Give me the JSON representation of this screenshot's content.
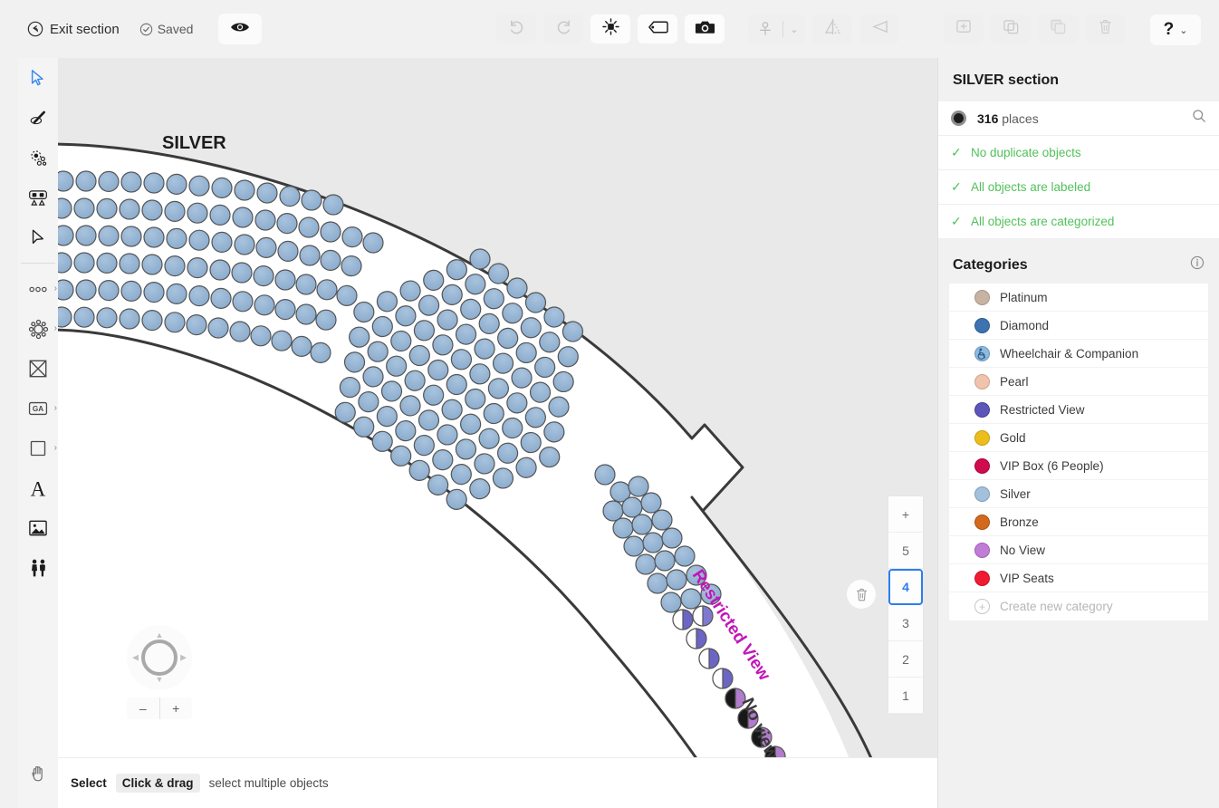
{
  "toolbar": {
    "exit_label": "Exit section",
    "saved_label": "Saved",
    "preview_icon": "eye-icon",
    "undo_icon": "undo-icon",
    "redo_icon": "redo-icon",
    "focal_icon": "focal-point-icon",
    "label_icon": "tag-icon",
    "camera_icon": "camera-icon",
    "align_icon": "align-icon",
    "align_chevron": "⌄",
    "flip_v_icon": "flip-vertical-icon",
    "flip_h_icon": "flip-horizontal-icon",
    "add_copy_icon": "add-duplicate-icon",
    "duplicate_icon": "duplicate-icon",
    "copy_icon": "copy-icon",
    "delete_icon": "trash-icon",
    "help_label": "?",
    "help_chevron": "⌄"
  },
  "tools": [
    {
      "name": "select-tool",
      "icon": "cursor-arrow-icon",
      "active": true,
      "chevron": ""
    },
    {
      "name": "magic-wand-tool",
      "icon": "magic-wand-icon",
      "active": false,
      "chevron": ""
    },
    {
      "name": "focal-point-tool",
      "icon": "focal-dots-icon",
      "active": false,
      "chevron": ""
    },
    {
      "name": "section-tool",
      "icon": "seating-section-icon",
      "active": false,
      "chevron": ""
    },
    {
      "name": "direct-select-tool",
      "icon": "solid-arrow-icon",
      "active": false,
      "chevron": ""
    },
    {
      "name": "row-tool",
      "icon": "row-of-seats-icon",
      "active": false,
      "chevron": "›"
    },
    {
      "name": "table-tool",
      "icon": "round-table-icon",
      "active": false,
      "chevron": "›"
    },
    {
      "name": "shape-tool",
      "icon": "crossed-box-icon",
      "active": false,
      "chevron": ""
    },
    {
      "name": "ga-tool",
      "icon": "general-admission-icon",
      "active": false,
      "chevron": "›"
    },
    {
      "name": "rectangle-tool",
      "icon": "square-icon",
      "active": false,
      "chevron": "›"
    },
    {
      "name": "text-tool",
      "icon": "letter-a-icon",
      "active": false,
      "chevron": ""
    },
    {
      "name": "image-tool",
      "icon": "picture-icon",
      "active": false,
      "chevron": ""
    },
    {
      "name": "people-tool",
      "icon": "two-people-icon",
      "active": false,
      "chevron": ""
    }
  ],
  "hand_tool": {
    "name": "pan-hand-tool",
    "icon": "hand-icon"
  },
  "canvas": {
    "section_label": "SILVER",
    "restricted_view_label": "Restricted View",
    "no_view_label": "No view",
    "seat_fill": "#8FAFD0",
    "seat_stroke": "#4a4a4a",
    "restricted_fill": "#5B56B8",
    "noview_fill": "#B27BCB",
    "bg": "#e9e9e9",
    "section_fill": "#ffffff",
    "restricted_label_color": "#C216B8",
    "noview_label_color": "#3a3a3a"
  },
  "navigation": {
    "pad_icon": "direction-pad",
    "up": "▲",
    "down": "▼",
    "left": "◀",
    "right": "▶",
    "zoom_out": "–",
    "zoom_in": "+"
  },
  "levels": {
    "add_label": "+",
    "items": [
      "5",
      "4",
      "3",
      "2",
      "1"
    ],
    "selected": "4",
    "delete_icon": "trash-icon"
  },
  "panel": {
    "title": "SILVER section",
    "places_count": "316",
    "places_word": "places",
    "search_icon": "search-icon",
    "checks": [
      "No duplicate objects",
      "All objects are labeled",
      "All objects are categorized"
    ],
    "check_mark": "✓",
    "categories_title": "Categories",
    "info_icon": "info-icon",
    "categories": [
      {
        "label": "Platinum",
        "color": "#C6B3A4"
      },
      {
        "label": "Diamond",
        "color": "#3E72B0"
      },
      {
        "label": "Wheelchair & Companion",
        "color": "#8FBADF",
        "icon": "wheelchair-icon"
      },
      {
        "label": "Pearl",
        "color": "#EFC3AC"
      },
      {
        "label": "Restricted View",
        "color": "#5B56B8"
      },
      {
        "label": "Gold",
        "color": "#EDBE1B"
      },
      {
        "label": "VIP Box (6 People)",
        "color": "#D00B4E"
      },
      {
        "label": "Silver",
        "color": "#A3C0DC"
      },
      {
        "label": "Bronze",
        "color": "#D2691C"
      },
      {
        "label": "No View",
        "color": "#C17DD6"
      },
      {
        "label": "VIP Seats",
        "color": "#F01B32"
      }
    ],
    "create_label": "Create new category",
    "create_icon": "plus-circle-icon"
  },
  "statusbar": {
    "action": "Select",
    "shortcut": "Click & drag",
    "description": "select multiple objects"
  }
}
